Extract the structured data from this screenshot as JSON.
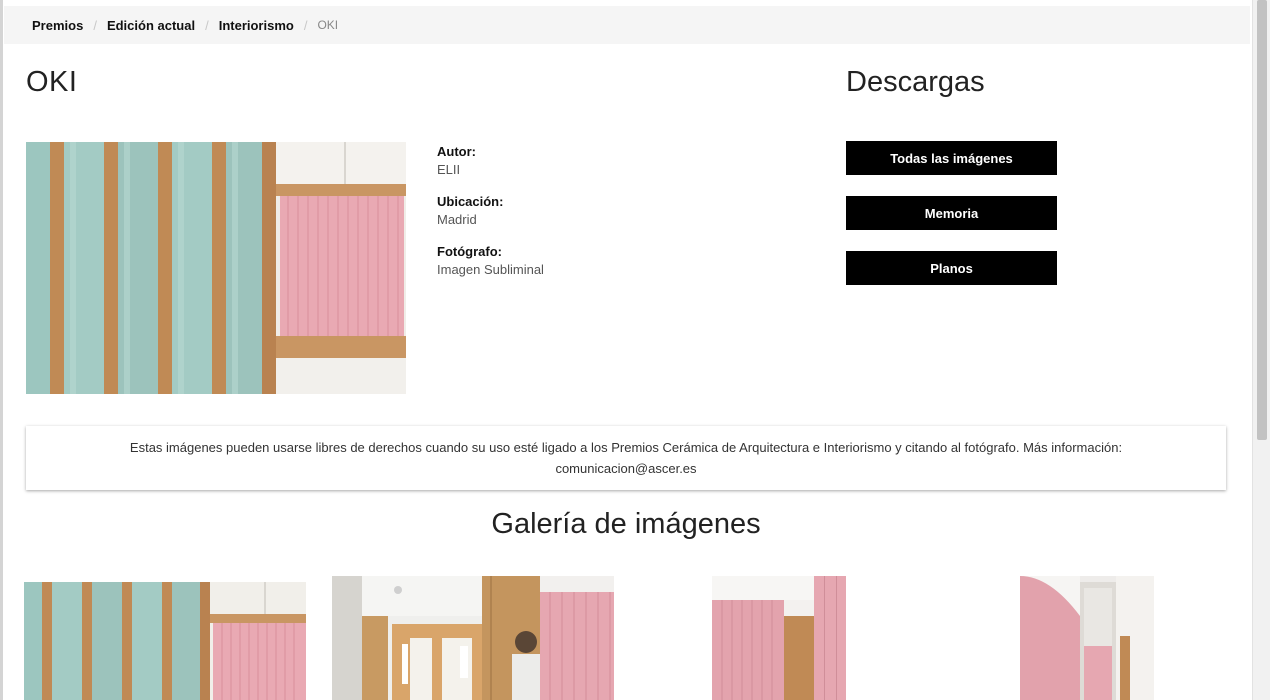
{
  "breadcrumb": {
    "items": [
      "Premios",
      "Edición actual",
      "Interiorismo"
    ],
    "separator": "/",
    "current": "OKI"
  },
  "project": {
    "title": "OKI",
    "author_label": "Autor:",
    "author": "ELII",
    "location_label": "Ubicación:",
    "location": "Madrid",
    "photographer_label": "Fotógrafo:",
    "photographer": "Imagen Subliminal"
  },
  "downloads": {
    "title": "Descargas",
    "all_images": "Todas las imágenes",
    "memory": "Memoria",
    "plans": "Planos"
  },
  "notice": {
    "text": "Estas imágenes pueden usarse libres de derechos cuando su uso esté ligado a los Premios Cerámica de Arquitectura e Interiorismo y citando al fotógrafo. Más información:",
    "email": "comunicacion@ascer.es"
  },
  "gallery": {
    "title": "Galería de imágenes"
  },
  "colors": {
    "button_bg": "#000000",
    "button_text": "#ffffff",
    "breadcrumb_bg": "#f5f5f5",
    "tile_pink": "#e9a3ae",
    "column_mint": "#9cc3bc",
    "wood": "#c08a55"
  }
}
